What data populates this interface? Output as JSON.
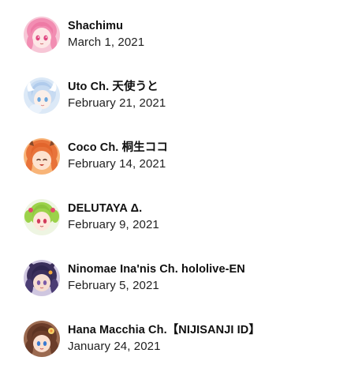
{
  "subscriptions": [
    {
      "name": "Shachimu",
      "date": "March 1, 2021",
      "avatar": "pink-hair-avatar",
      "colors": {
        "bg": "#f7c6d6",
        "hair": "#f28db2",
        "face": "#fde7e6"
      }
    },
    {
      "name": "Uto Ch. 天使うと",
      "date": "February 21, 2021",
      "avatar": "light-blue-angel-avatar",
      "colors": {
        "bg": "#dce9f7",
        "hair": "#b9d2ee",
        "face": "#fbefe9"
      }
    },
    {
      "name": "Coco Ch. 桐生ココ",
      "date": "February 14, 2021",
      "avatar": "orange-hair-dragon-avatar",
      "colors": {
        "bg": "#f39a4a",
        "hair": "#e8733a",
        "face": "#fde2cf"
      }
    },
    {
      "name": "DELUTAYA Δ.",
      "date": "February 9, 2021",
      "avatar": "green-twintail-avatar",
      "colors": {
        "bg": "#e9f3d8",
        "hair": "#9bd24a",
        "face": "#fde8dc"
      }
    },
    {
      "name": "Ninomae Ina'nis Ch. hololive-EN",
      "date": "February 5, 2021",
      "avatar": "purple-tentacle-avatar",
      "colors": {
        "bg": "#4a4070",
        "hair": "#3b2f5c",
        "face": "#f6ddd0"
      }
    },
    {
      "name": "Hana Macchia Ch.【NIJISANJI ID】",
      "date": "January 24, 2021",
      "avatar": "brown-hair-flower-avatar",
      "colors": {
        "bg": "#7a4a35",
        "hair": "#6b3d2a",
        "face": "#fbe0d0"
      }
    }
  ]
}
